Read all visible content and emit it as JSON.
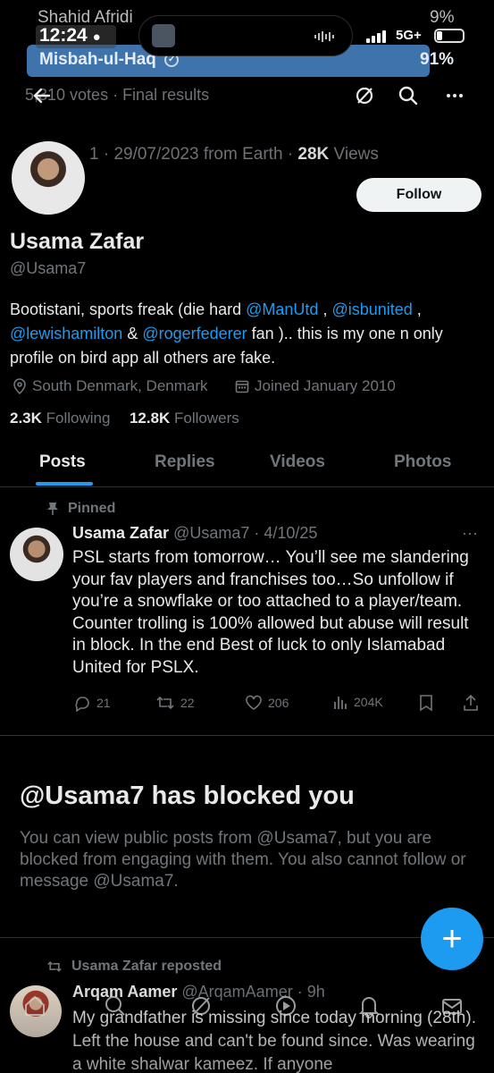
{
  "status_bar": {
    "ghost_name": "Shahid Afridi",
    "ghost_percent": "9%",
    "time": "12:24",
    "network": "5G+",
    "battery_level": 0.2
  },
  "poll": {
    "option_label": "Misbah-ul-Haq",
    "option_percent": "91%",
    "option_fill": 0.91,
    "votes_text": "5,310 votes · Final results"
  },
  "nav": {
    "icons": [
      "back-arrow-icon",
      "grok-icon",
      "search-icon",
      "more-icon"
    ]
  },
  "profile": {
    "meta_prefix": "1 · 29/07/2023 from Earth · ",
    "meta_views": "28K",
    "meta_views_label": " Views",
    "follow_label": "Follow",
    "name": "Usama Zafar",
    "handle": "@Usama7",
    "bio_1": "Bootistani, sports freak (die hard ",
    "bio_mention_1": "@ManUtd",
    "bio_2": " , ",
    "bio_mention_2": "@isbunited",
    "bio_3": " , ",
    "bio_mention_3": "@lewishamilton",
    "bio_4": " & ",
    "bio_mention_4": "@rogerfederer",
    "bio_5": " fan ).. this is my one n only profile on bird app all others are fake.",
    "location": "South Denmark, Denmark",
    "joined": "Joined January 2010",
    "following_count": "2.3K",
    "following_label": " Following",
    "followers_count": "12.8K",
    "followers_label": " Followers"
  },
  "tabs": [
    "Posts",
    "Replies",
    "Videos",
    "Photos"
  ],
  "pinned_post": {
    "pinned_label": "Pinned",
    "author": "Usama Zafar",
    "handle_date": " @Usama7 · 4/10/25",
    "more": "···",
    "text": "PSL starts from tomorrow… You’ll see me slandering your fav players and franchises too…So unfollow if you’re a snowflake or too attached to a player/team. Counter trolling is 100% allowed but abuse will result in block. In the end Best of luck to only Islamabad United for PSLX.",
    "replies": "21",
    "reposts": "22",
    "likes": "206",
    "views": "204K"
  },
  "blocked": {
    "title": "@Usama7 has blocked you",
    "text": "You can view public posts from @Usama7, but you are blocked from engaging with them. You also cannot follow or message @Usama7."
  },
  "fab": {
    "label": "+"
  },
  "repost": {
    "label": "Usama Zafar reposted",
    "author": "Arqam Aamer",
    "handle_time": " @ArqamAamer · 9h",
    "text": "My grandfather is missing since today morning (28th). Left the house and can't be found since. Was wearing a white shalwar kameez. If anyone"
  },
  "colors": {
    "accent": "#1d9bf0",
    "poll_fill": "#3e73ac",
    "muted": "#71767b",
    "background": "#000000"
  }
}
